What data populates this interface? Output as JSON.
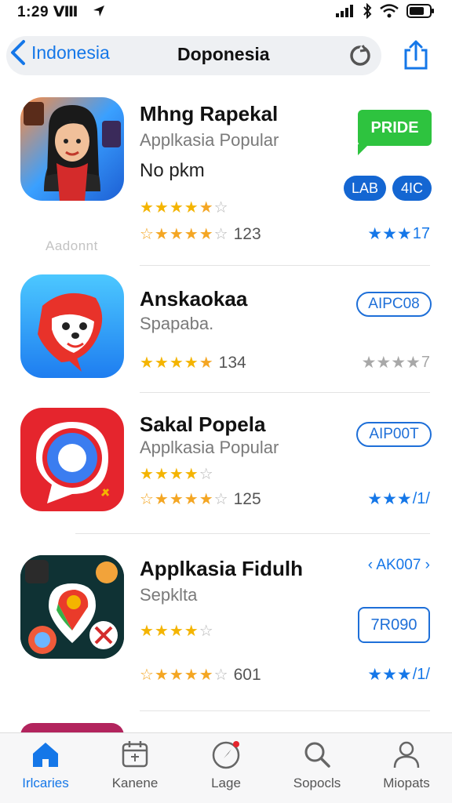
{
  "status_bar": {
    "time": "1:29 Ⅷ",
    "icons": [
      "signal-icon",
      "bluetooth-icon",
      "wifi-icon",
      "battery-icon"
    ]
  },
  "nav": {
    "back_label": "Indonesia",
    "title": "Doponesia",
    "icons": [
      "back-chevron-icon",
      "reload-icon",
      "share-icon"
    ]
  },
  "apps": [
    {
      "name": "Mhng Rapekal",
      "subtitle": "Applkasia Popular",
      "extra": "No pkm",
      "rating_a": "",
      "rating_b_count": "123",
      "price_badge": "PRIDE",
      "chip_left": "LAB",
      "chip_right": "4IC",
      "right_rating": "17",
      "caption": "Aadonnt"
    },
    {
      "name": "Anskaokaa",
      "subtitle": "Spapaba.",
      "rating_count": "134",
      "button": "AIPC08",
      "right_rating": "7"
    },
    {
      "name": "Sakal Popela",
      "subtitle": "Applkasia Popular",
      "rating_b_count": "125",
      "button": "AIP00T",
      "right_rating": "/1/"
    },
    {
      "name": "Applkasia Fidulh",
      "subtitle": "Sepklta",
      "rating_b_count": "601",
      "link": "‹ AK007 ›",
      "price_box": "7R090",
      "right_rating": "/1/"
    }
  ],
  "tabs": [
    {
      "label": "Irlcaries",
      "icon": "home-icon",
      "active": true
    },
    {
      "label": "Kanene",
      "icon": "calendar-icon",
      "active": false
    },
    {
      "label": "Lage",
      "icon": "compass-icon",
      "active": false
    },
    {
      "label": "Sopocls",
      "icon": "search-icon",
      "active": false
    },
    {
      "label": "Miopats",
      "icon": "person-icon",
      "active": false
    }
  ],
  "colors": {
    "accent": "#1577e8",
    "star": "#f4b400",
    "green_badge": "#2ec33f"
  }
}
